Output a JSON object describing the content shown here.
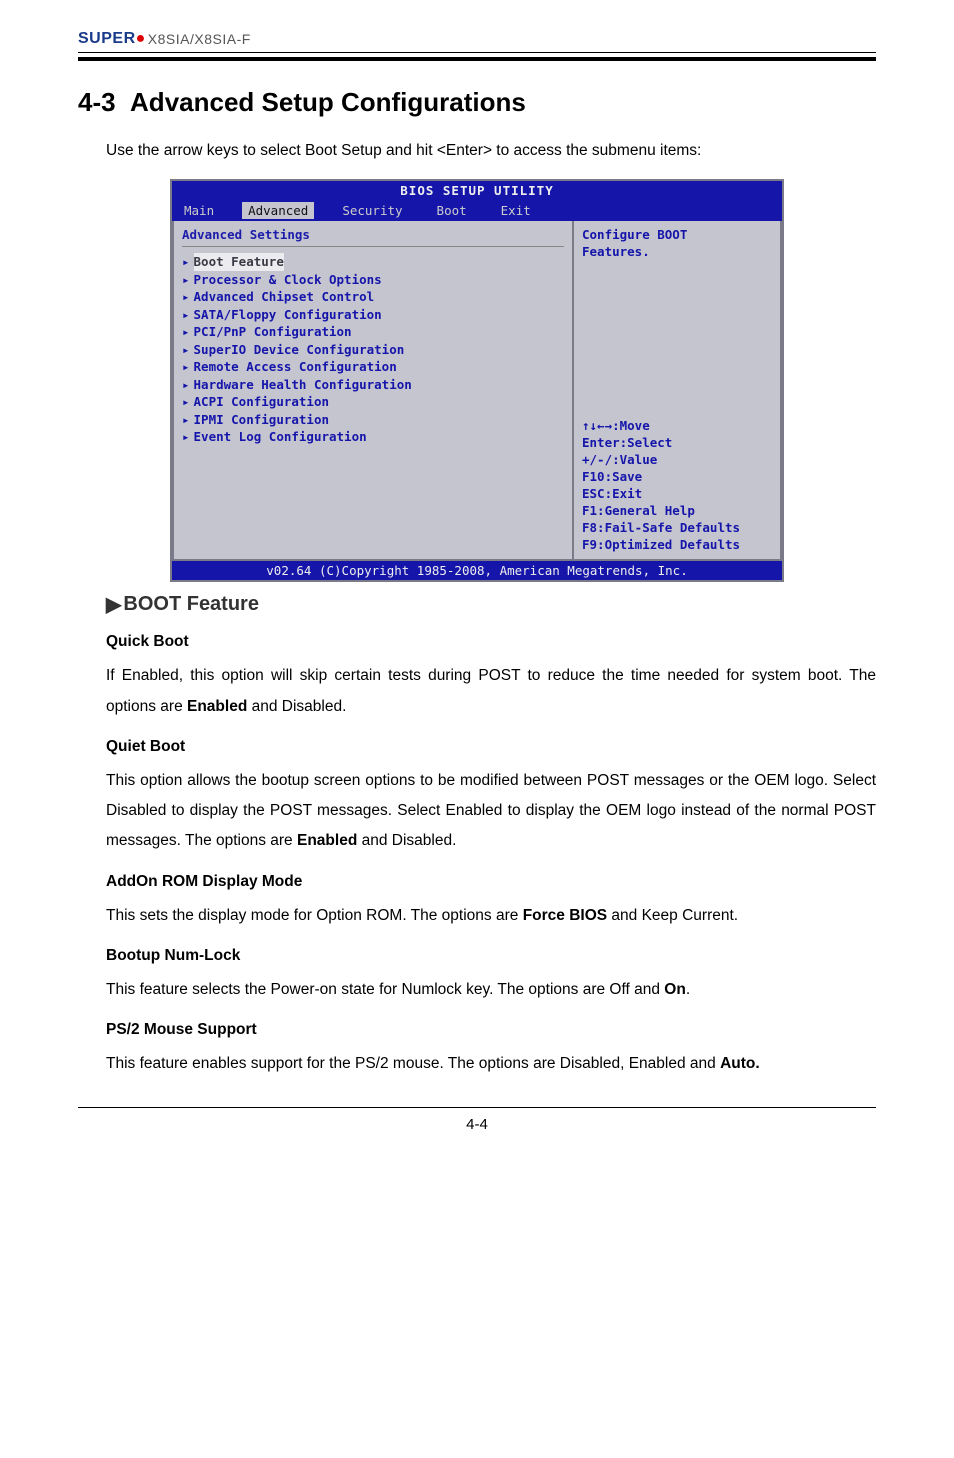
{
  "header": {
    "brand": "SUPER",
    "model": "X8SIA/X8SIA-F"
  },
  "section": {
    "number": "4-3",
    "title": "Advanced Setup Configurations",
    "intro": "Use the arrow keys to select Boot Setup and hit <Enter> to access the submenu items:"
  },
  "bios": {
    "title": "BIOS SETUP UTILITY",
    "tabs": [
      "Main",
      "Advanced",
      "Security",
      "Boot",
      "Exit"
    ],
    "active_tab": "Advanced",
    "left_heading": "Advanced Settings",
    "menu_items": [
      "Boot Feature",
      "Processor & Clock Options",
      "Advanced Chipset Control",
      "SATA/Floppy Configuration",
      "PCI/PnP Configuration",
      "SuperIO Device Configuration",
      "Remote Access Configuration",
      "Hardware Health Configuration",
      "ACPI Configuration",
      "IPMI Configuration",
      "Event Log Configuration"
    ],
    "selected_index": 0,
    "right_top": [
      "Configure BOOT",
      "Features."
    ],
    "right_help": [
      "↑↓←→:Move",
      "Enter:Select",
      "+/-/:Value",
      "F10:Save",
      "ESC:Exit",
      "F1:General Help",
      "F8:Fail-Safe Defaults",
      "F9:Optimized Defaults"
    ],
    "footer": "v02.64 (C)Copyright 1985-2008, American Megatrends, Inc."
  },
  "boot_feature_heading": "BOOT Feature",
  "items": [
    {
      "title": "Quick Boot",
      "body_parts": [
        "If Enabled, this option will skip certain tests during POST  to reduce the time needed for system boot. The options are ",
        "Enabled",
        " and Disabled."
      ],
      "bold_idx": [
        1
      ]
    },
    {
      "title": "Quiet Boot",
      "body_parts": [
        "This option allows the bootup screen options to be modified between POST messages or the OEM logo. Select Disabled to display the POST messages. Select Enabled to display the OEM logo instead of the normal POST messages. The options are ",
        "Enabled",
        " and Disabled."
      ],
      "bold_idx": [
        1
      ]
    },
    {
      "title": "AddOn ROM Display Mode",
      "body_parts": [
        "This sets the display mode for Option ROM.  The options are ",
        "Force BIOS",
        " and Keep Current."
      ],
      "bold_idx": [
        1
      ]
    },
    {
      "title": "Bootup Num-Lock",
      "body_parts": [
        "This feature selects the Power-on state for Numlock key.  The options are Off and ",
        "On",
        "."
      ],
      "bold_idx": [
        1
      ]
    },
    {
      "title": "PS/2 Mouse Support",
      "body_parts": [
        "This feature enables support for the PS/2 mouse.  The options are Disabled, Enabled and ",
        "Auto.",
        ""
      ],
      "bold_idx": [
        1
      ]
    }
  ],
  "page_number": "4-4"
}
